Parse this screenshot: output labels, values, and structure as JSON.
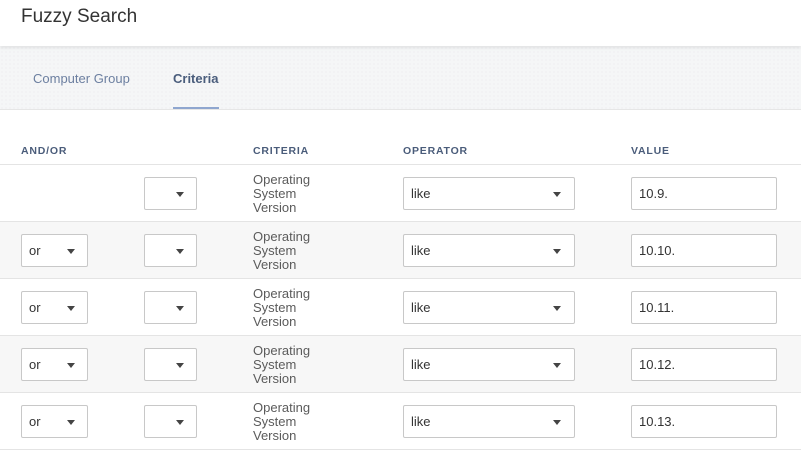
{
  "page": {
    "title": "Fuzzy Search"
  },
  "tabs": {
    "computer_group": "Computer Group",
    "criteria": "Criteria"
  },
  "table": {
    "headers": {
      "andor": "AND/OR",
      "criteria": "CRITERIA",
      "operator": "OPERATOR",
      "value": "VALUE"
    },
    "rows": [
      {
        "andor": "",
        "criteria": "Operating System Version",
        "operator": "like",
        "value": "10.9."
      },
      {
        "andor": "or",
        "criteria": "Operating System Version",
        "operator": "like",
        "value": "10.10."
      },
      {
        "andor": "or",
        "criteria": "Operating System Version",
        "operator": "like",
        "value": "10.11."
      },
      {
        "andor": "or",
        "criteria": "Operating System Version",
        "operator": "like",
        "value": "10.12."
      },
      {
        "andor": "or",
        "criteria": "Operating System Version",
        "operator": "like",
        "value": "10.13."
      }
    ]
  }
}
